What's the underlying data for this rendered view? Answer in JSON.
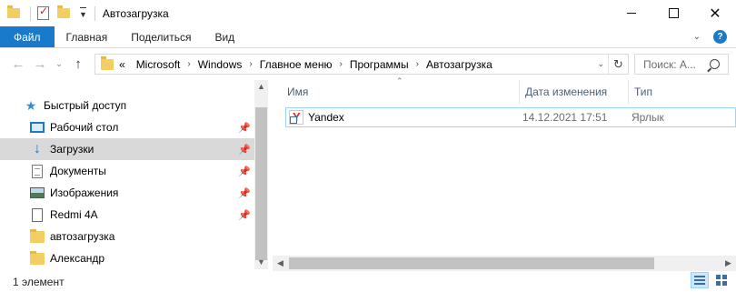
{
  "window": {
    "title": "Автозагрузка",
    "controls": {
      "minimize": "",
      "maximize": "",
      "close": "✕"
    }
  },
  "ribbon": {
    "tabs": [
      {
        "label": "Файл"
      },
      {
        "label": "Главная"
      },
      {
        "label": "Поделиться"
      },
      {
        "label": "Вид"
      }
    ],
    "help_label": "?"
  },
  "navigation": {
    "back": "←",
    "forward": "→",
    "recent": "⌄",
    "up": "↑",
    "breadcrumb": [
      "«",
      "Microsoft",
      "Windows",
      "Главное меню",
      "Программы",
      "Автозагрузка"
    ],
    "breadcrumb_separator": "›",
    "refresh": "↻"
  },
  "search": {
    "placeholder": "Поиск: А..."
  },
  "sidebar": {
    "items": [
      {
        "label": "Быстрый доступ",
        "icon": "star-icon",
        "pinned": false
      },
      {
        "label": "Рабочий стол",
        "icon": "desktop-icon",
        "pinned": true
      },
      {
        "label": "Загрузки",
        "icon": "download-icon",
        "pinned": true,
        "selected": true
      },
      {
        "label": "Документы",
        "icon": "documents-icon",
        "pinned": true
      },
      {
        "label": "Изображения",
        "icon": "pictures-icon",
        "pinned": true
      },
      {
        "label": "Redmi 4A",
        "icon": "device-icon",
        "pinned": true
      },
      {
        "label": "автозагрузка",
        "icon": "folder-icon",
        "pinned": false
      },
      {
        "label": "Александр",
        "icon": "folder-icon",
        "pinned": false
      }
    ],
    "pin_glyph": "📌"
  },
  "columns": {
    "name": "Имя",
    "date": "Дата изменения",
    "type": "Тип"
  },
  "files": [
    {
      "name": "Yandex",
      "date": "14.12.2021 17:51",
      "type": "Ярлык",
      "icon": "yandex-shortcut-icon"
    }
  ],
  "status": {
    "count": "1 элемент"
  }
}
